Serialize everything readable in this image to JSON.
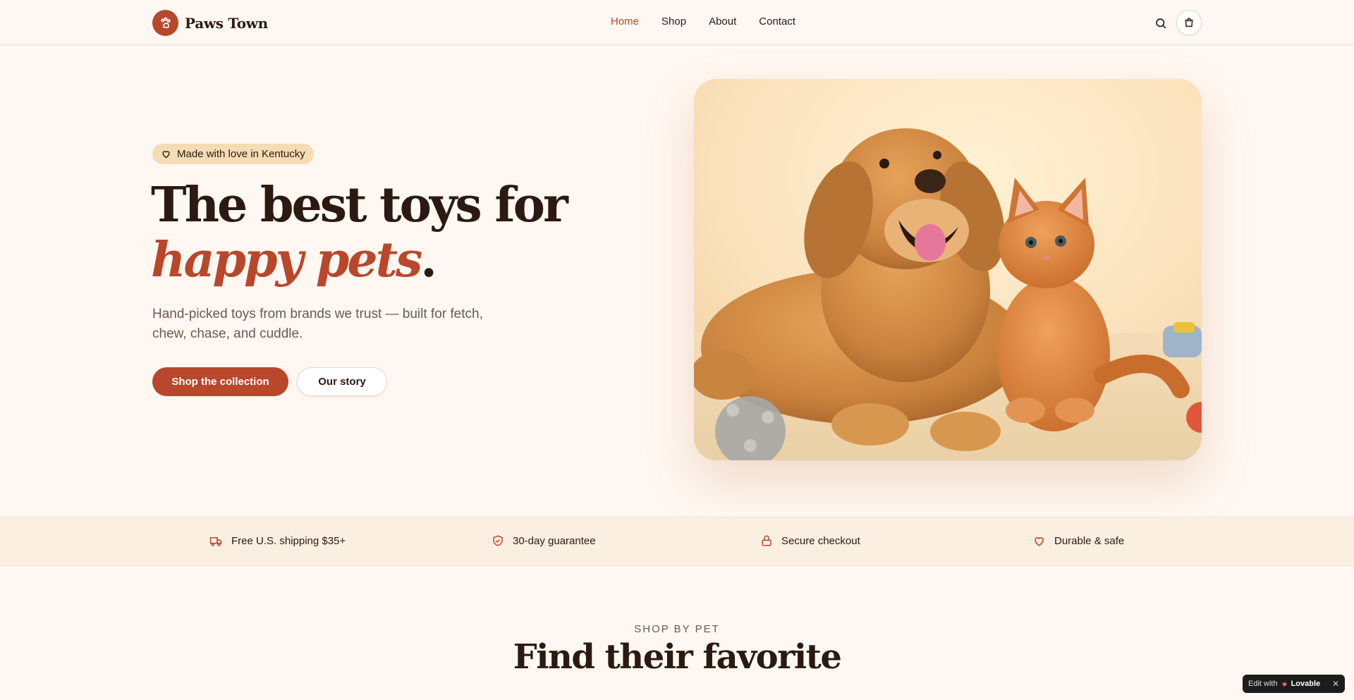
{
  "brand": {
    "name": "Paws Town",
    "logo_icon": "paw-icon",
    "accent": "#b9472b"
  },
  "nav": {
    "items": [
      {
        "label": "Home",
        "active": true
      },
      {
        "label": "Shop",
        "active": false
      },
      {
        "label": "About",
        "active": false
      },
      {
        "label": "Contact",
        "active": false
      }
    ],
    "search_icon": "search-icon",
    "cart_icon": "shopping-bag-icon"
  },
  "hero": {
    "badge": "Made with love in Kentucky",
    "title_line1": "The best toys for",
    "title_accent": "happy pets",
    "title_period": ".",
    "subtitle": "Hand-picked toys from brands we trust — built for fetch, chew, chase, and cuddle.",
    "primary_cta": "Shop the collection",
    "secondary_cta": "Our story"
  },
  "features": [
    {
      "icon": "truck-icon",
      "label": "Free U.S. shipping $35+"
    },
    {
      "icon": "shield-check-icon",
      "label": "30-day guarantee"
    },
    {
      "icon": "lock-icon",
      "label": "Secure checkout"
    },
    {
      "icon": "heart-icon",
      "label": "Durable & safe"
    }
  ],
  "section": {
    "eyebrow": "SHOP BY PET",
    "title": "Find their favorite"
  },
  "lovable": {
    "prefix": "Edit with",
    "brand": "Lovable",
    "close": "✕"
  },
  "colors": {
    "background": "#fff8f2",
    "accent": "#b9472b",
    "badge_bg": "#f6dcb4",
    "strip_bg": "#fbefe1",
    "text": "#2a1a12"
  }
}
